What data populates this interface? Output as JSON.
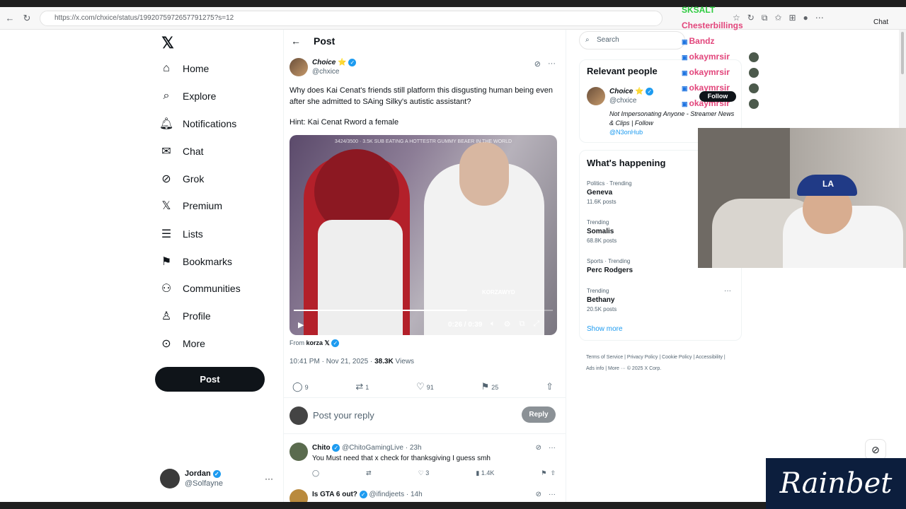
{
  "browser": {
    "url": "https://x.com/chxice/status/1992075972657791275?s=12",
    "chat_label": "Chat"
  },
  "nav": {
    "items": [
      {
        "label": "Home",
        "icon": "home-icon",
        "glyph": "⌂"
      },
      {
        "label": "Explore",
        "icon": "search-icon",
        "glyph": "⌕"
      },
      {
        "label": "Notifications",
        "icon": "bell-icon",
        "glyph": "🔔︎"
      },
      {
        "label": "Chat",
        "icon": "envelope-icon",
        "glyph": "✉"
      },
      {
        "label": "Grok",
        "icon": "grok-icon",
        "glyph": "⊘"
      },
      {
        "label": "Premium",
        "icon": "x-premium-icon",
        "glyph": "𝕏"
      },
      {
        "label": "Lists",
        "icon": "list-icon",
        "glyph": "☰"
      },
      {
        "label": "Bookmarks",
        "icon": "bookmark-icon",
        "glyph": "⚑"
      },
      {
        "label": "Communities",
        "icon": "people-icon",
        "glyph": "⚇"
      },
      {
        "label": "Profile",
        "icon": "person-icon",
        "glyph": "♙"
      },
      {
        "label": "More",
        "icon": "more-circle-icon",
        "glyph": "⊙"
      }
    ],
    "post_label": "Post"
  },
  "account": {
    "name": "Jordan",
    "handle": "@Solfayne"
  },
  "main": {
    "title": "Post",
    "tweet": {
      "author_name": "Choice",
      "author_handle": "@chxice",
      "text": "Why does Kai Cenat's friends still platform this disgusting human being even after she admitted to SAing Silky's autistic assistant?",
      "hint": "Hint: Kai Cenat Rword a female",
      "video": {
        "caption": "3424/3500 · 3.5K SUB EATING A HOTTESTR GUMMY BEAER IN THE WORLD",
        "tag": "KORZAWYD",
        "time": "0:26 / 0:39",
        "progress": 0.67
      },
      "from_label": "From",
      "from_name": "korza 𝕏",
      "timestamp": "10:41 PM · Nov 21, 2025 ·",
      "views": "38.3K",
      "views_label": "Views",
      "replies": "9",
      "reposts": "1",
      "likes": "91",
      "bookmarks": "25"
    },
    "reply_placeholder": "Post your reply",
    "reply_button": "Reply",
    "replies": [
      {
        "name": "Chito",
        "handle": "@ChitoGamingLive · 23h",
        "text": "You Must need that x check for thanksgiving I guess smh",
        "replies": "",
        "reposts": "",
        "likes": "3",
        "views": "1.4K"
      },
      {
        "name": "Is GTA 6 out?",
        "handle": "@ifindjeets · 14h",
        "text": "",
        "replies": "",
        "reposts": "",
        "likes": "",
        "views": ""
      }
    ]
  },
  "right": {
    "search_placeholder": "Search",
    "relevant_title": "Relevant people",
    "relevant": {
      "name": "Choice",
      "handle": "@chxice",
      "bio": "Not Impersonating Anyone - Streamer News & Clips",
      "bio_follow": "| Follow",
      "bio_link": "@N3onHub"
    },
    "happening_title": "What's happening",
    "trends": [
      {
        "context": "Politics · Trending",
        "title": "Geneva",
        "posts": "11.6K posts"
      },
      {
        "context": "Trending",
        "title": "Somalis",
        "posts": "68.8K posts"
      },
      {
        "context": "Sports · Trending",
        "title": "Perc Rodgers",
        "posts": ""
      },
      {
        "context": "Trending",
        "title": "Bethany",
        "posts": "20.5K posts"
      }
    ],
    "show_more": "Show more",
    "footer": "Terms of Service  |  Privacy Policy  |  Cookie Policy  |  Accessibility  |  Ads info  |  More ···  © 2025 X Corp."
  },
  "overlay": {
    "chat_names": [
      "SKSALT",
      "Chesterbillings",
      "Bandz",
      "okaymrsir",
      "okaymrsir",
      "okaymrsir",
      "okaymrsir"
    ],
    "follow_label": "Follow",
    "sponsor": "Rainbet",
    "cap_letter": "LA"
  }
}
